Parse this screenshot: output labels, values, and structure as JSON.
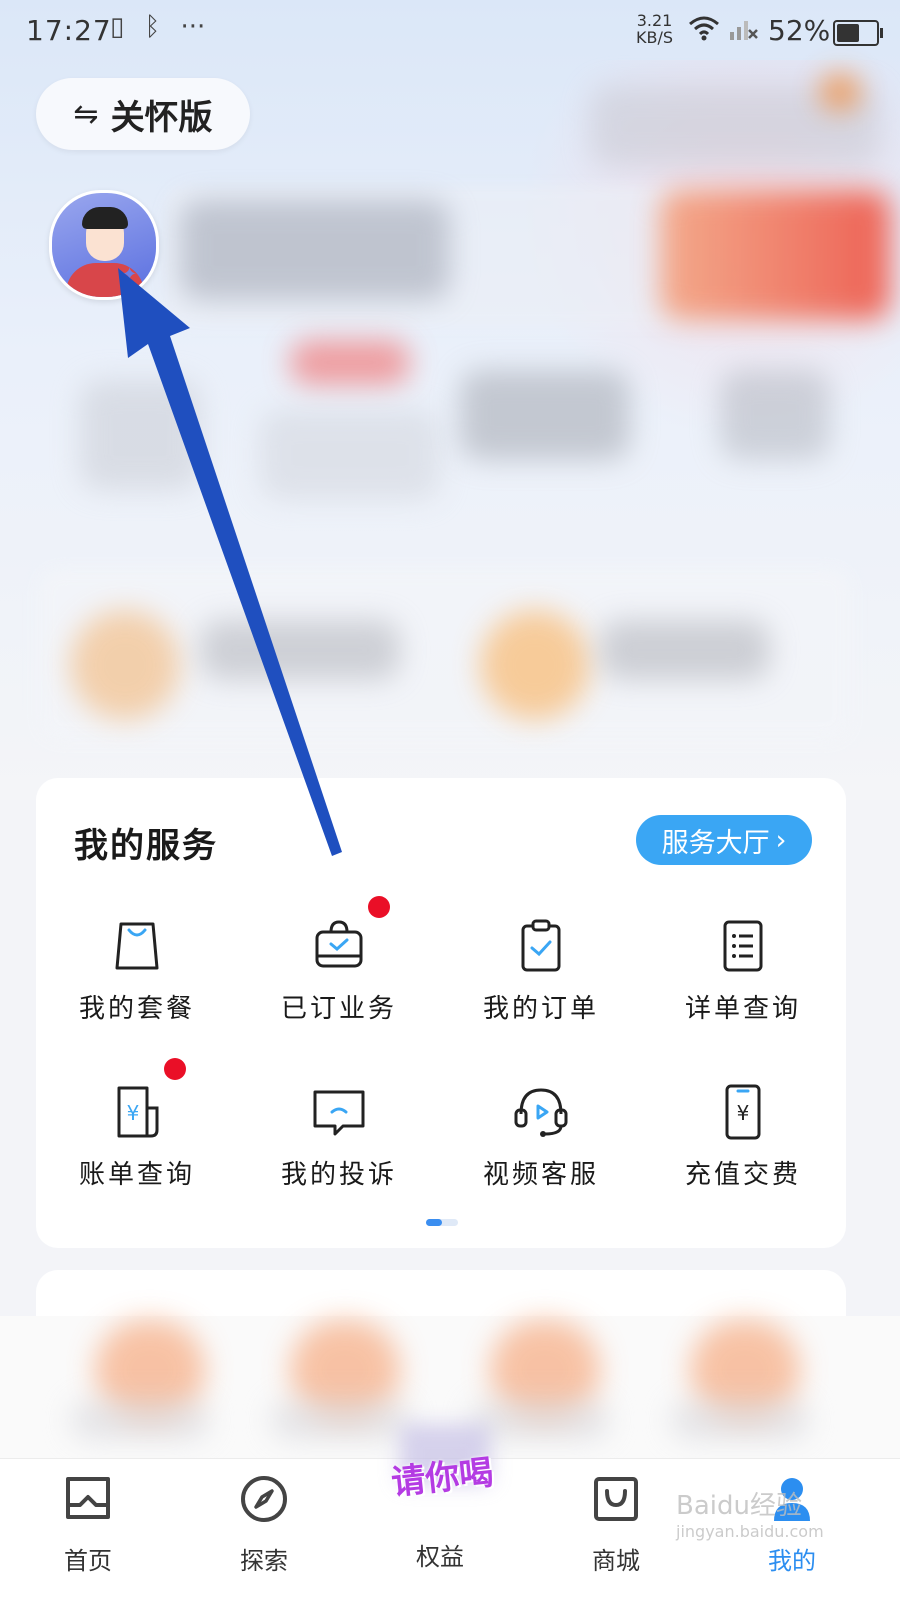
{
  "status_bar": {
    "time": "17:27",
    "net_speed_value": "3.21",
    "net_speed_unit": "KB/S",
    "battery": "52%",
    "battery_level": 0.52
  },
  "care_mode": {
    "icon": "swap-arrows-icon",
    "label": "关怀版"
  },
  "services": {
    "title": "我的服务",
    "hall_button": "服务大厅",
    "items": [
      {
        "label": "我的套餐",
        "icon": "shopping-bag-icon",
        "badge": false
      },
      {
        "label": "已订业务",
        "icon": "briefcase-check-icon",
        "badge": true
      },
      {
        "label": "我的订单",
        "icon": "clipboard-check-icon",
        "badge": false
      },
      {
        "label": "详单查询",
        "icon": "list-document-icon",
        "badge": false
      },
      {
        "label": "账单查询",
        "icon": "bill-yuan-icon",
        "badge": true
      },
      {
        "label": "我的投诉",
        "icon": "message-bubble-icon",
        "badge": false
      },
      {
        "label": "视频客服",
        "icon": "headset-video-icon",
        "badge": false
      },
      {
        "label": "充值交费",
        "icon": "phone-yuan-icon",
        "badge": false
      }
    ],
    "page_index": 1,
    "page_count": 2
  },
  "bottom_nav": {
    "items": [
      {
        "label": "首页",
        "icon": "home-icon",
        "active": false
      },
      {
        "label": "探索",
        "icon": "compass-icon",
        "active": false
      },
      {
        "label": "权益",
        "icon": "rights-promo-icon",
        "active": false
      },
      {
        "label": "商城",
        "icon": "shop-bag-icon",
        "active": false
      },
      {
        "label": "我的",
        "icon": "user-icon",
        "active": true
      }
    ],
    "promo_text": "请你喝"
  },
  "colors": {
    "accent": "#3aa6f4",
    "badge_red": "#ea0f27",
    "active_tab": "#2c8ef0",
    "annotation_arrow": "#1f4fbf"
  },
  "watermark": {
    "text": "Baidu经验",
    "sub": "jingyan.baidu.com"
  }
}
